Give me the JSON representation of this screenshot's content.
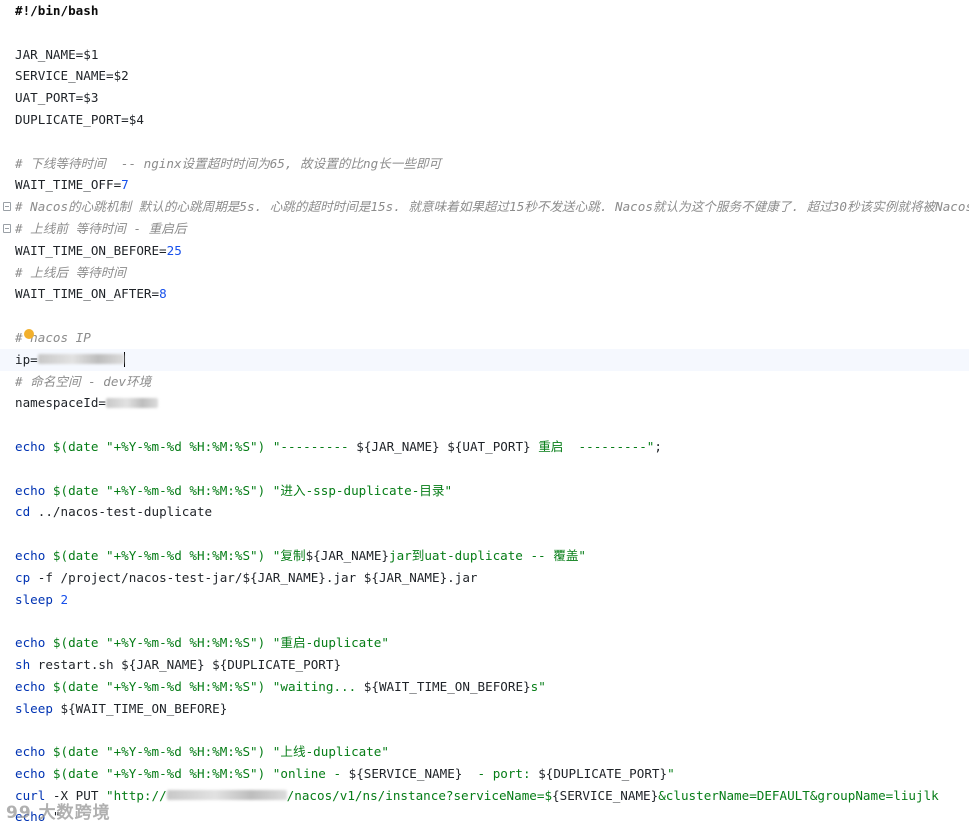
{
  "editor": {
    "lines": [
      {
        "segments": [
          {
            "c": "t-shebang",
            "t": "#!/bin/bash"
          }
        ]
      },
      {
        "segments": []
      },
      {
        "segments": [
          {
            "c": "t-var",
            "t": "JAR_NAME=$1"
          }
        ]
      },
      {
        "segments": [
          {
            "c": "t-var",
            "t": "SERVICE_NAME=$2"
          }
        ]
      },
      {
        "segments": [
          {
            "c": "t-var",
            "t": "UAT_PORT=$3"
          }
        ]
      },
      {
        "segments": [
          {
            "c": "t-var",
            "t": "DUPLICATE_PORT=$4"
          }
        ]
      },
      {
        "segments": []
      },
      {
        "segments": [
          {
            "c": "t-comment",
            "t": "# 下线等待时间  -- nginx设置超时时间为65, 故设置的比ng长一些即可"
          }
        ]
      },
      {
        "segments": [
          {
            "c": "t-var",
            "t": "WAIT_TIME_OFF="
          },
          {
            "c": "t-num",
            "t": "7"
          }
        ]
      },
      {
        "fold": true,
        "segments": [
          {
            "c": "t-comment",
            "t": "# Nacos的心跳机制 默认的心跳周期是5s. 心跳的超时时间是15s. 就意味着如果超过15秒不发送心跳. Nacos就认为这个服务不健康了. 超过30秒该实例就将被Nacos"
          }
        ]
      },
      {
        "fold": true,
        "segments": [
          {
            "c": "t-comment",
            "t": "# 上线前 等待时间 - 重启后"
          }
        ]
      },
      {
        "segments": [
          {
            "c": "t-var",
            "t": "WAIT_TIME_ON_BEFORE="
          },
          {
            "c": "t-num",
            "t": "25"
          }
        ]
      },
      {
        "segments": [
          {
            "c": "t-comment",
            "t": "# 上线后 等待时间"
          }
        ]
      },
      {
        "segments": [
          {
            "c": "t-var",
            "t": "WAIT_TIME_ON_AFTER="
          },
          {
            "c": "t-num",
            "t": "8"
          }
        ]
      },
      {
        "segments": []
      },
      {
        "bulb": true,
        "segments": [
          {
            "c": "t-comment",
            "t": "# nacos IP"
          }
        ]
      },
      {
        "current": true,
        "segments": [
          {
            "c": "t-var",
            "t": "ip="
          },
          {
            "blur": 86
          },
          {
            "caret": true
          }
        ]
      },
      {
        "segments": [
          {
            "c": "t-comment",
            "t": "# 命名空间 - dev环境"
          }
        ]
      },
      {
        "segments": [
          {
            "c": "t-var",
            "t": "namespaceId="
          },
          {
            "blur": 52
          }
        ]
      },
      {
        "segments": []
      },
      {
        "segments": [
          {
            "c": "t-kw",
            "t": "echo "
          },
          {
            "c": "t-str",
            "t": "$(date "
          },
          {
            "c": "t-str",
            "t": "\"+%Y-%m-%d %H:%M:%S\")"
          },
          {
            "c": "t-str",
            "t": " \"--------- "
          },
          {
            "c": "t-interp",
            "t": "${JAR_NAME} ${UAT_PORT}"
          },
          {
            "c": "t-str",
            "t": " 重启  ---------\""
          },
          {
            "c": "t-plain",
            "t": ";"
          }
        ]
      },
      {
        "segments": []
      },
      {
        "segments": [
          {
            "c": "t-kw",
            "t": "echo "
          },
          {
            "c": "t-str",
            "t": "$(date \"+%Y-%m-%d %H:%M:%S\") \"进入-ssp-duplicate-目录\""
          }
        ]
      },
      {
        "segments": [
          {
            "c": "t-kw",
            "t": "cd "
          },
          {
            "c": "t-plain",
            "t": "../nacos-test-duplicate"
          }
        ]
      },
      {
        "segments": []
      },
      {
        "segments": [
          {
            "c": "t-kw",
            "t": "echo "
          },
          {
            "c": "t-str",
            "t": "$(date \"+%Y-%m-%d %H:%M:%S\") \"复制"
          },
          {
            "c": "t-interp",
            "t": "${JAR_NAME}"
          },
          {
            "c": "t-str",
            "t": "jar到uat-duplicate -- 覆盖\""
          }
        ]
      },
      {
        "segments": [
          {
            "c": "t-kw",
            "t": "cp "
          },
          {
            "c": "t-plain",
            "t": "-f /project/nacos-test-jar/${JAR_NAME}.jar ${JAR_NAME}.jar"
          }
        ]
      },
      {
        "segments": [
          {
            "c": "t-kw",
            "t": "sleep "
          },
          {
            "c": "t-num",
            "t": "2"
          }
        ]
      },
      {
        "segments": []
      },
      {
        "segments": [
          {
            "c": "t-kw",
            "t": "echo "
          },
          {
            "c": "t-str",
            "t": "$(date \"+%Y-%m-%d %H:%M:%S\") \"重启-duplicate\""
          }
        ]
      },
      {
        "segments": [
          {
            "c": "t-kw",
            "t": "sh "
          },
          {
            "c": "t-plain",
            "t": "restart.sh ${JAR_NAME} ${DUPLICATE_PORT}"
          }
        ]
      },
      {
        "segments": [
          {
            "c": "t-kw",
            "t": "echo "
          },
          {
            "c": "t-str",
            "t": "$(date \"+%Y-%m-%d %H:%M:%S\") \"waiting... "
          },
          {
            "c": "t-interp",
            "t": "${WAIT_TIME_ON_BEFORE}"
          },
          {
            "c": "t-str",
            "t": "s\""
          }
        ]
      },
      {
        "segments": [
          {
            "c": "t-kw",
            "t": "sleep "
          },
          {
            "c": "t-plain",
            "t": "${WAIT_TIME_ON_BEFORE}"
          }
        ]
      },
      {
        "segments": []
      },
      {
        "segments": [
          {
            "c": "t-kw",
            "t": "echo "
          },
          {
            "c": "t-str",
            "t": "$(date \"+%Y-%m-%d %H:%M:%S\") \"上线-duplicate\""
          }
        ]
      },
      {
        "segments": [
          {
            "c": "t-kw",
            "t": "echo "
          },
          {
            "c": "t-str",
            "t": "$(date \"+%Y-%m-%d %H:%M:%S\") \"online - "
          },
          {
            "c": "t-interp",
            "t": "${SERVICE_NAME}"
          },
          {
            "c": "t-str",
            "t": "  - port: "
          },
          {
            "c": "t-interp",
            "t": "${DUPLICATE_PORT}"
          },
          {
            "c": "t-str",
            "t": "\""
          }
        ]
      },
      {
        "segments": [
          {
            "c": "t-kw",
            "t": "curl "
          },
          {
            "c": "t-plain",
            "t": "-X PUT "
          },
          {
            "c": "t-str",
            "t": "\"http://"
          },
          {
            "blur": 120
          },
          {
            "c": "t-str",
            "t": "/nacos/v1/ns/instance?serviceName=$"
          },
          {
            "c": "t-interp",
            "t": "{SERVICE_NAME}"
          },
          {
            "c": "t-str",
            "t": "&clusterName=DEFAULT&groupName=liujlk"
          }
        ]
      },
      {
        "segments": [
          {
            "c": "t-kw",
            "t": "echo "
          },
          {
            "c": "t-plain",
            "t": "\""
          }
        ]
      }
    ]
  },
  "watermark": {
    "text": "99 大数跨境"
  }
}
